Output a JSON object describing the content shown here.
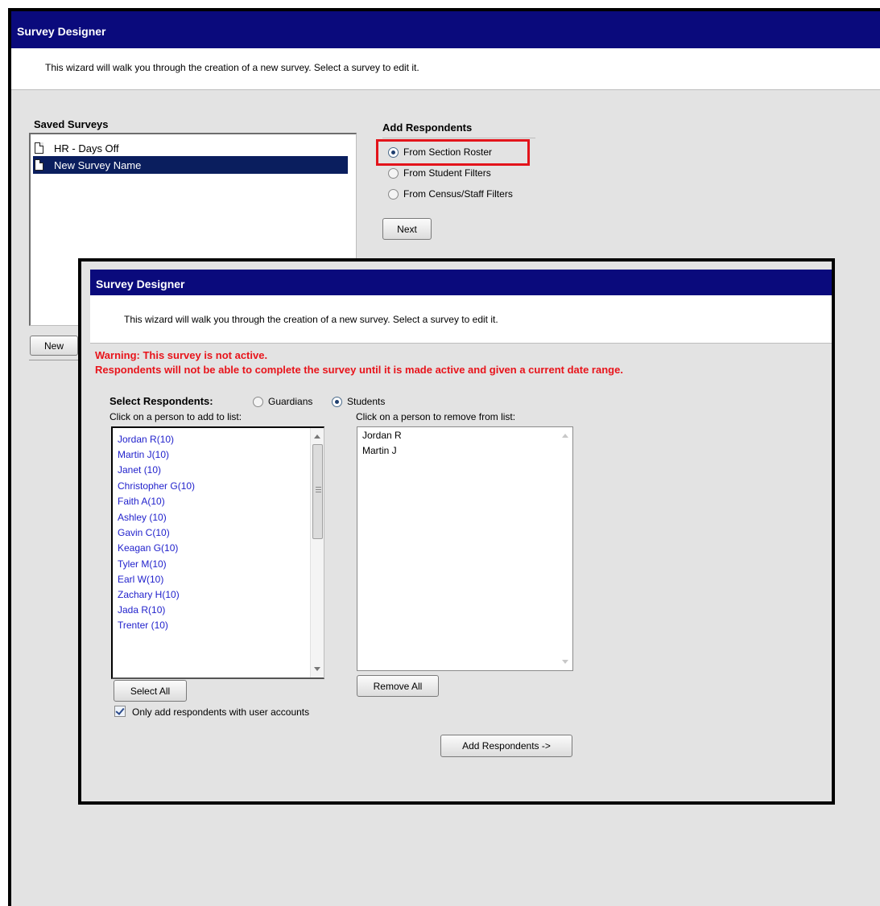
{
  "background_window": {
    "title": "Survey Designer",
    "intro": "This wizard will walk you through the creation of a new survey. Select a survey to edit it.",
    "saved_surveys_label": "Saved Surveys",
    "saved_surveys": [
      {
        "label": "HR - Days Off",
        "selected": false
      },
      {
        "label": "New Survey Name",
        "selected": true
      }
    ],
    "new_button": "New",
    "add_respondents_label": "Add Respondents",
    "respondent_sources": [
      {
        "label": "From Section Roster",
        "checked": true
      },
      {
        "label": "From Student Filters",
        "checked": false
      },
      {
        "label": "From Census/Staff Filters",
        "checked": false
      }
    ],
    "next_button": "Next",
    "highlight_color": "#e3141b"
  },
  "dialog": {
    "title": "Survey Designer",
    "intro": "This wizard will walk you through the creation of a new survey. Select a survey to edit it.",
    "warning_line1": "Warning: This survey is not active.",
    "warning_line2": "Respondents will not be able to complete the survey until it is made active and given a current date range.",
    "warning_color": "#e8141b",
    "select_respondents_label": "Select Respondents:",
    "respondent_types": [
      {
        "label": "Guardians",
        "checked": false
      },
      {
        "label": "Students",
        "checked": true
      }
    ],
    "click_add_label": "Click on a person to add to list:",
    "click_remove_label": "Click on a person to remove from list:",
    "available_people": [
      "Jordan R(10)",
      "Martin J(10)",
      "Janet (10)",
      "Christopher G(10)",
      "Faith A(10)",
      "Ashley (10)",
      "Gavin C(10)",
      "Keagan G(10)",
      "Tyler M(10)",
      "Earl W(10)",
      "Zachary H(10)",
      "Jada R(10)",
      "Trenter (10)"
    ],
    "selected_people": [
      "Jordan R",
      "Martin J"
    ],
    "select_all_button": "Select All",
    "remove_all_button": "Remove All",
    "user_accounts_label": "Only add respondents with user accounts",
    "user_accounts_checked": true,
    "add_respondents_button": "Add Respondents ->"
  }
}
